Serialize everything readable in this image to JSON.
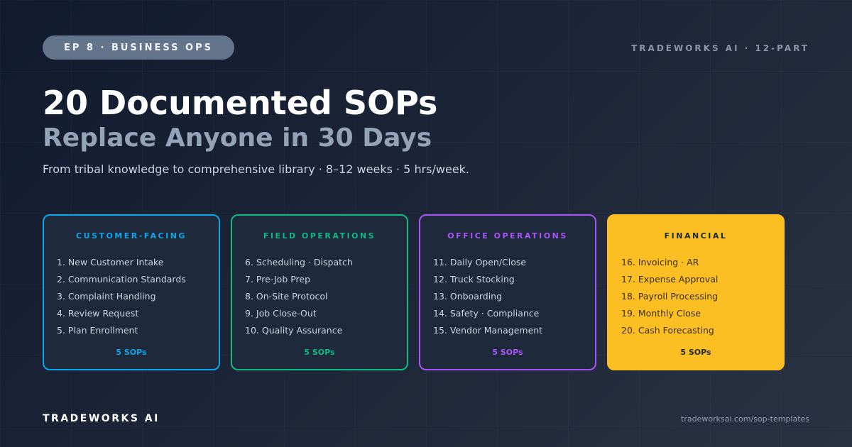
{
  "header": {
    "episode_pill": "EP 8 · BUSINESS OPS",
    "series_label": "TRADEWORKS AI · 12-PART"
  },
  "hero": {
    "title": "20 Documented SOPs",
    "subtitle": "Replace Anyone in 30 Days",
    "description": "From tribal knowledge to comprehensive library · 8–12 weeks · 5 hrs/week."
  },
  "cards": [
    {
      "title": "CUSTOMER-FACING",
      "color": "#0ea5e9",
      "items": [
        "1. New Customer Intake",
        "2. Communication Standards",
        "3. Complaint Handling",
        "4. Review Request",
        "5. Plan Enrollment"
      ],
      "count": "5 SOPs"
    },
    {
      "title": "FIELD OPERATIONS",
      "color": "#10b981",
      "items": [
        "6. Scheduling · Dispatch",
        "7. Pre-Job Prep",
        "8. On-Site Protocol",
        "9. Job Close-Out",
        "10. Quality Assurance"
      ],
      "count": "5 SOPs"
    },
    {
      "title": "OFFICE OPERATIONS",
      "color": "#a855f7",
      "items": [
        "11. Daily Open/Close",
        "12. Truck Stocking",
        "13. Onboarding",
        "14. Safety · Compliance",
        "15. Vendor Management"
      ],
      "count": "5 SOPs"
    },
    {
      "title": "FINANCIAL",
      "color": "#fbbf24",
      "items": [
        "16. Invoicing · AR",
        "17. Expense Approval",
        "18. Payroll Processing",
        "19. Monthly Close",
        "20. Cash Forecasting"
      ],
      "count": "5 SOPs"
    }
  ],
  "footer": {
    "brand": "TRADEWORKS AI",
    "url": "tradeworksai.com/sop-templates"
  }
}
